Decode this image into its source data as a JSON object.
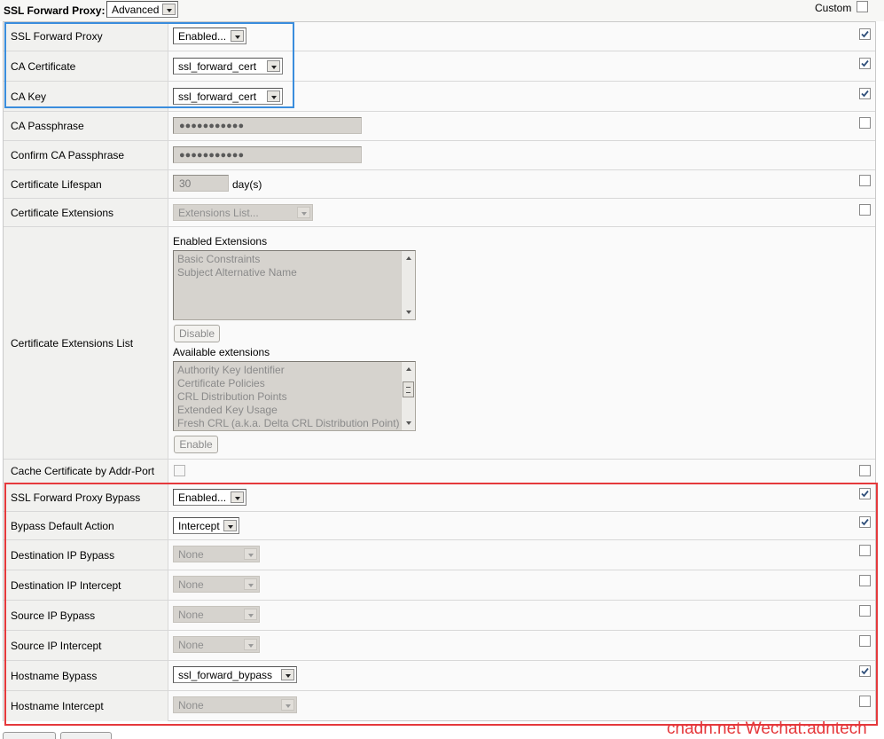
{
  "header": {
    "title": "SSL Forward Proxy:",
    "mode_select": "Advanced",
    "custom_label": "Custom",
    "custom_checked": false
  },
  "rows": [
    {
      "label": "SSL Forward Proxy",
      "value": "Enabled...",
      "checked": true
    },
    {
      "label": "CA Certificate",
      "value": "ssl_forward_cert",
      "checked": true
    },
    {
      "label": "CA Key",
      "value": "ssl_forward_cert",
      "checked": true
    },
    {
      "label": "CA Passphrase",
      "value": "●●●●●●●●●●●",
      "checked": false
    },
    {
      "label": "Confirm CA Passphrase",
      "value": "●●●●●●●●●●●"
    },
    {
      "label": "Certificate Lifespan",
      "value": "30",
      "unit": "day(s)",
      "checked": false
    },
    {
      "label": "Certificate Extensions",
      "value": "Extensions List...",
      "checked": false
    },
    {
      "label": "Certificate Extensions List"
    },
    {
      "label": "Cache Certificate by Addr-Port",
      "checked": false
    },
    {
      "label": "SSL Forward Proxy Bypass",
      "value": "Enabled...",
      "checked": true
    },
    {
      "label": "Bypass Default Action",
      "value": "Intercept",
      "checked": true
    },
    {
      "label": "Destination IP Bypass",
      "value": "None",
      "checked": false
    },
    {
      "label": "Destination IP Intercept",
      "value": "None",
      "checked": false
    },
    {
      "label": "Source IP Bypass",
      "value": "None",
      "checked": false
    },
    {
      "label": "Source IP Intercept",
      "value": "None",
      "checked": false
    },
    {
      "label": "Hostname Bypass",
      "value": "ssl_forward_bypass",
      "checked": true
    },
    {
      "label": "Hostname Intercept",
      "value": "None",
      "checked": false
    }
  ],
  "extensions": {
    "enabled_caption": "Enabled Extensions",
    "enabled_items": [
      "Basic Constraints",
      "Subject Alternative Name"
    ],
    "disable_button": "Disable",
    "available_caption": "Available extensions",
    "available_items": [
      "Authority Key Identifier",
      "Certificate Policies",
      "CRL Distribution Points",
      "Extended Key Usage",
      "Fresh CRL (a.k.a. Delta CRL Distribution Point)"
    ],
    "enable_button": "Enable"
  },
  "watermark": "cnadn.net Wechat:adntech",
  "colors": {
    "highlight_blue": "#3a8ddd",
    "highlight_red": "#e5393c",
    "disabled_field": "#d6d3ce"
  }
}
